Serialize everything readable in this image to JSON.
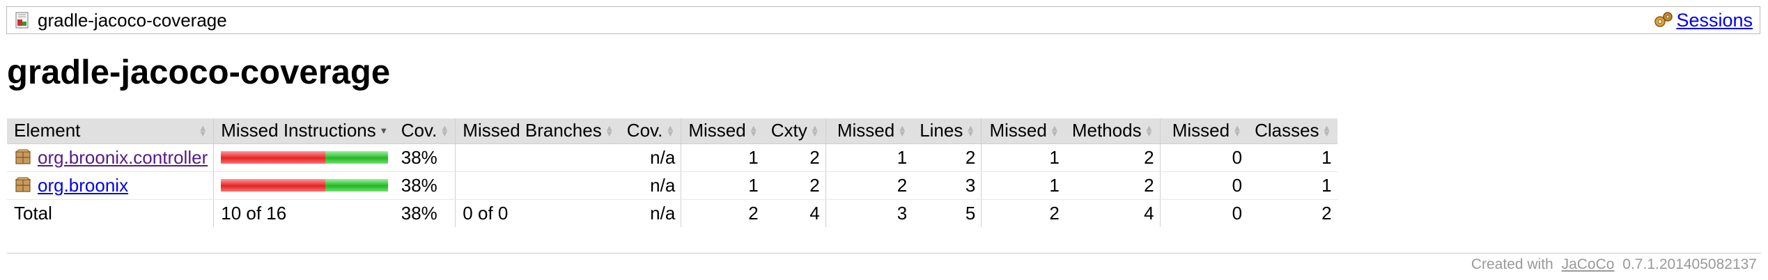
{
  "breadcrumb": {
    "title": "gradle-jacoco-coverage",
    "report_icon": "report-icon",
    "sessions_icon": "sessions-icon",
    "sessions_label": "Sessions"
  },
  "page_title": "gradle-jacoco-coverage",
  "table": {
    "headers": {
      "element": "Element",
      "missed_instructions": "Missed Instructions",
      "instr_cov": "Cov.",
      "missed_branches": "Missed Branches",
      "branch_cov": "Cov.",
      "missed_cxty": "Missed",
      "cxty": "Cxty",
      "missed_lines": "Missed",
      "lines": "Lines",
      "missed_methods": "Missed",
      "methods": "Methods",
      "missed_classes": "Missed",
      "classes": "Classes"
    },
    "sorted_column": "missed_instructions",
    "rows": [
      {
        "element": "org.broonix.controller",
        "icon": "package-icon",
        "visited": true,
        "instr_missed_fraction": 0.625,
        "instr_cov": "38%",
        "branch_cov": "n/a",
        "missed_cxty": "1",
        "cxty": "2",
        "missed_lines": "1",
        "lines": "2",
        "missed_methods": "1",
        "methods": "2",
        "missed_classes": "0",
        "classes": "1"
      },
      {
        "element": "org.broonix",
        "icon": "package-icon",
        "visited": false,
        "instr_missed_fraction": 0.625,
        "instr_cov": "38%",
        "branch_cov": "n/a",
        "missed_cxty": "1",
        "cxty": "2",
        "missed_lines": "2",
        "lines": "3",
        "missed_methods": "1",
        "methods": "2",
        "missed_classes": "0",
        "classes": "1"
      }
    ],
    "total": {
      "label": "Total",
      "missed_instructions": "10 of 16",
      "instr_cov": "38%",
      "missed_branches": "0 of 0",
      "branch_cov": "n/a",
      "missed_cxty": "2",
      "cxty": "4",
      "missed_lines": "3",
      "lines": "5",
      "missed_methods": "2",
      "methods": "4",
      "missed_classes": "0",
      "classes": "2"
    }
  },
  "footer": {
    "prefix": "Created with",
    "link": "JaCoCo",
    "version": "0.7.1.201405082137"
  },
  "colors": {
    "missed_bar": "#e42323",
    "covered_bar": "#22b822",
    "header_bg": "#e0e0e0",
    "link": "#0000ee",
    "visited_link": "#551a8b"
  }
}
